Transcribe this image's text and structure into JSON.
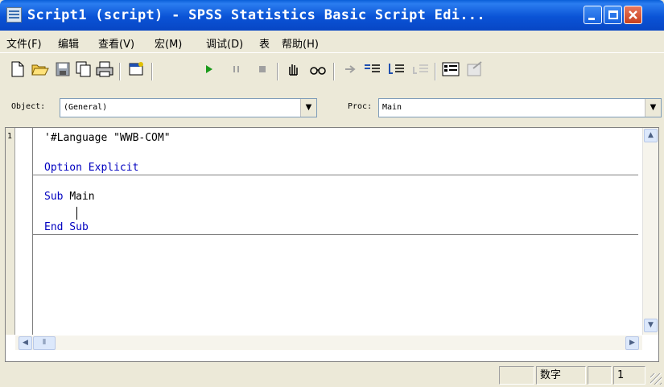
{
  "window": {
    "title": "Script1 (script) - SPSS Statistics Basic Script Edi..."
  },
  "menu": [
    {
      "label": "文件(F)"
    },
    {
      "label": "编辑"
    },
    {
      "label": "查看(V)"
    },
    {
      "label": "宏(M)"
    },
    {
      "label": "调试(D)"
    },
    {
      "label": "表"
    },
    {
      "label": "帮助(H)"
    }
  ],
  "selectors": {
    "object_label": "Object:",
    "object_value": "(General)",
    "proc_label": "Proc:",
    "proc_value": "Main"
  },
  "editor": {
    "line_number": "1",
    "lines": {
      "language": "'#Language \"WWB-COM\"",
      "option_kw": "Option Explicit",
      "sub_kw": "Sub",
      "sub_name": "Main",
      "end_sub": "End Sub"
    }
  },
  "status": {
    "mode": "数字",
    "line": "1"
  }
}
